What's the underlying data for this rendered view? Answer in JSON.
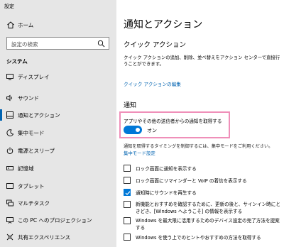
{
  "window": {
    "title": "設定"
  },
  "sidebar": {
    "home_label": "ホーム",
    "search_placeholder": "設定の検索",
    "section_label": "システム",
    "items": [
      {
        "label": "ディスプレイ",
        "icon": "display-icon",
        "active": false
      },
      {
        "label": "サウンド",
        "icon": "speaker-icon",
        "active": false
      },
      {
        "label": "通知とアクション",
        "icon": "notification-icon",
        "active": true
      },
      {
        "label": "集中モード",
        "icon": "moon-icon",
        "active": false
      },
      {
        "label": "電源とスリープ",
        "icon": "power-icon",
        "active": false
      },
      {
        "label": "記憶域",
        "icon": "storage-icon",
        "active": false
      },
      {
        "label": "タブレット",
        "icon": "tablet-icon",
        "active": false
      },
      {
        "label": "マルチタスク",
        "icon": "multitask-icon",
        "active": false
      },
      {
        "label": "この PC へのプロジェクション",
        "icon": "projection-icon",
        "active": false
      },
      {
        "label": "共有エクスペリエンス",
        "icon": "share-icon",
        "active": false
      }
    ]
  },
  "main": {
    "title": "通知とアクション",
    "quick_action": {
      "heading": "クイック アクション",
      "description": "クイック アクションの追加、削除、並べ替えをアクション センターで直接行うことができます。",
      "edit_link": "クイック アクションの編集"
    },
    "notifications": {
      "heading": "通知",
      "toggle_label": "アプリやその他の送信者からの通知を取得する",
      "toggle_state": "オン",
      "toggle_on": true,
      "focus_hint": "通知を取得するタイミングを制御するには、集中モードをご利用ください。",
      "focus_link": "集中モード設定",
      "options": [
        {
          "label": "ロック画面に通知を表示する",
          "checked": false
        },
        {
          "label": "ロック画面にリマインダーと VoIP の着信を表示する",
          "checked": false
        },
        {
          "label": "通知時にサウンドを再生する",
          "checked": true
        },
        {
          "label_lines": [
            "新機能とおすすめを確認するために、更新の後と、サインイン時にときどき、[Windows へようこそ] の情報を表示する"
          ],
          "checked": false
        },
        {
          "label_lines": [
            "Windows を最大限に活用するためのデバイス設定の完了方法を提案する"
          ],
          "checked": false
        },
        {
          "label": "Windows を使う上でのヒントやおすすめの方法を取得する",
          "checked": false
        }
      ]
    }
  },
  "colors": {
    "accent": "#0078d7",
    "link": "#0063b1",
    "highlight": "#ef8fb9",
    "sidebar_bg": "#e6e6e6"
  }
}
